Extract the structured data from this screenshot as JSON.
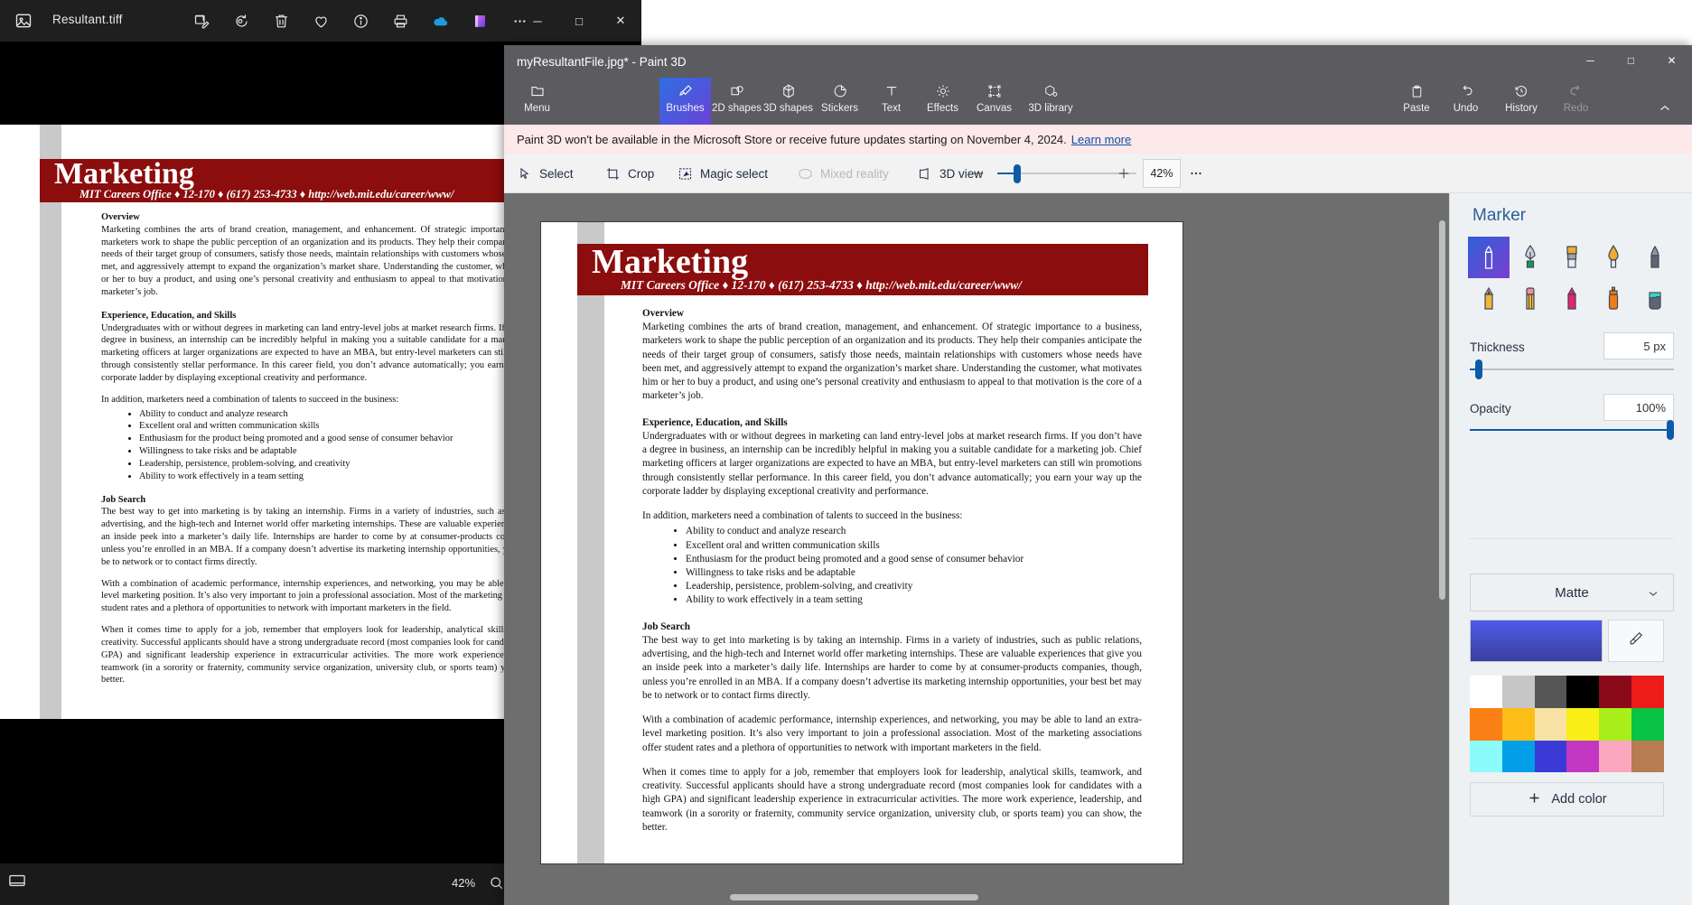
{
  "photos_window": {
    "app_icon": "photo-icon",
    "filename": "Resultant.tiff",
    "toolbar_icons": [
      {
        "name": "edit-image-icon",
        "label": "Edit image"
      },
      {
        "name": "rotate-icon",
        "label": "Rotate"
      },
      {
        "name": "delete-icon",
        "label": "Delete"
      },
      {
        "name": "favorite-heart-icon",
        "label": "Add to favorites"
      },
      {
        "name": "info-icon",
        "label": "File info"
      },
      {
        "name": "print-icon",
        "label": "Print"
      },
      {
        "name": "onedrive-icon",
        "label": "OneDrive"
      },
      {
        "name": "designer-icon",
        "label": "Designer"
      },
      {
        "name": "more-icon",
        "label": "See more"
      }
    ],
    "window_controls": {
      "minimize": "─",
      "maximize": "□",
      "close": "✕"
    },
    "status": {
      "zoom": "42%",
      "zoom_icon": "magnifier-icon",
      "gallery_icon": "filmstrip-icon"
    }
  },
  "paint3d": {
    "title": "myResultantFile.jpg* - Paint 3D",
    "window_controls": {
      "minimize": "─",
      "maximize": "□",
      "close": "✕"
    },
    "ribbon": {
      "menu": {
        "label": "Menu",
        "icon": "folder-icon"
      },
      "tools": [
        {
          "label": "Brushes",
          "icon": "brush-icon",
          "selected": true
        },
        {
          "label": "2D shapes",
          "icon": "2d-shapes-icon",
          "selected": false
        },
        {
          "label": "3D shapes",
          "icon": "3d-shapes-icon",
          "selected": false
        },
        {
          "label": "Stickers",
          "icon": "stickers-icon",
          "selected": false
        },
        {
          "label": "Text",
          "icon": "text-icon",
          "selected": false
        },
        {
          "label": "Effects",
          "icon": "effects-icon",
          "selected": false
        },
        {
          "label": "Canvas",
          "icon": "canvas-icon",
          "selected": false
        },
        {
          "label": "3D library",
          "icon": "3d-library-icon",
          "selected": false
        }
      ],
      "right_tools": [
        {
          "label": "Paste",
          "icon": "paste-icon",
          "disabled": false
        },
        {
          "label": "Undo",
          "icon": "undo-icon",
          "disabled": false
        },
        {
          "label": "History",
          "icon": "history-icon",
          "disabled": false
        },
        {
          "label": "Redo",
          "icon": "redo-icon",
          "disabled": true
        }
      ],
      "collapse_icon": "chevron-up-icon"
    },
    "banner": {
      "text": "Paint 3D won't be available in the Microsoft Store or receive future updates starting on November 4, 2024.",
      "link": "Learn more"
    },
    "toolstrip": {
      "items": [
        {
          "label": "Select",
          "icon": "cursor-select-icon",
          "disabled": false
        },
        {
          "label": "Crop",
          "icon": "crop-icon",
          "disabled": false
        },
        {
          "label": "Magic select",
          "icon": "magic-select-icon",
          "disabled": false
        },
        {
          "label": "Mixed reality",
          "icon": "mixed-reality-icon",
          "disabled": true
        },
        {
          "label": "3D view",
          "icon": "3d-view-icon",
          "disabled": false
        }
      ],
      "zoom_out_icon": "minus-icon",
      "zoom_in_icon": "plus-icon",
      "zoom_value": "42%",
      "more_icon": "more-icon"
    },
    "panel": {
      "title": "Marker",
      "brushes": [
        {
          "name": "marker-brush",
          "selected": true
        },
        {
          "name": "calligraphy-pen-brush",
          "selected": false
        },
        {
          "name": "oil-brush",
          "selected": false
        },
        {
          "name": "watercolor-brush",
          "selected": false
        },
        {
          "name": "pixel-pen-brush",
          "selected": false
        },
        {
          "name": "pencil-brush",
          "selected": false
        },
        {
          "name": "eraser-brush",
          "selected": false
        },
        {
          "name": "crayon-brush",
          "selected": false
        },
        {
          "name": "spray-can-brush",
          "selected": false
        },
        {
          "name": "fill-bucket-brush",
          "selected": false
        }
      ],
      "thickness": {
        "label": "Thickness",
        "value": "5 px",
        "percent": 4
      },
      "opacity": {
        "label": "Opacity",
        "value": "100%",
        "percent": 100
      },
      "material": {
        "value": "Matte",
        "chevron": "chevron-down-icon"
      },
      "current_color": "#4550d8",
      "eyedropper_icon": "eyedropper-icon",
      "swatches": [
        "#ffffff",
        "#c6c6c6",
        "#565656",
        "#000000",
        "#8b0a1a",
        "#ee1b1b",
        "#fa8016",
        "#fbbd16",
        "#f8e2a3",
        "#f9ef16",
        "#a8ef1a",
        "#09c344",
        "#8cfbfb",
        "#029fe8",
        "#3a3ad6",
        "#c238c2",
        "#fca7c0",
        "#b77c52"
      ],
      "add_color": {
        "label": "Add color",
        "icon": "plus-icon"
      }
    }
  },
  "document": {
    "header_title": "Marketing",
    "header_sub": "MIT Careers Office ♦ 12-170 ♦ (617) 253-4733 ♦ http://web.mit.edu/career/www/",
    "sections": [
      {
        "heading": "Overview",
        "paragraphs": [
          "Marketing combines the arts of brand creation, management, and enhancement.  Of strategic importance to a business, marketers work to shape the public perception of an organization and its products.  They help their companies anticipate the needs of their target group of consumers, satisfy those needs, maintain relationships with customers whose needs have been met, and aggressively attempt to expand the organization’s market share.  Understanding the customer, what motivates him or her to buy a product, and using one’s personal creativity and enthusiasm to appeal to that motivation is the core of a marketer’s job."
        ]
      },
      {
        "heading": "Experience, Education, and Skills",
        "paragraphs": [
          "Undergraduates with or without degrees in marketing can land entry-level jobs at market research firms.  If you don’t have a degree in business, an internship can be incredibly helpful in making you a suitable candidate for a marketing job.  Chief marketing officers at larger organizations are expected to have an MBA, but entry-level marketers can still win promotions through consistently stellar performance.  In this career field, you don’t advance automatically; you earn your way up the corporate ladder by displaying exceptional creativity and performance.",
          "In addition, marketers need a combination of talents to succeed in the business:"
        ],
        "bullets": [
          "Ability to conduct and analyze research",
          "Excellent oral and written communication skills",
          "Enthusiasm for the product being promoted and a good sense of consumer behavior",
          "Willingness to take risks and be adaptable",
          "Leadership, persistence, problem-solving, and creativity",
          "Ability to work effectively in a team setting"
        ]
      },
      {
        "heading": "Job Search",
        "paragraphs": [
          "The best way to get into marketing is by taking an internship.  Firms in a variety of industries, such as public relations, advertising, and the high-tech and Internet world offer marketing internships.  These are valuable experiences that give you an inside peek into a marketer’s daily life.  Internships are harder to come by at consumer-products companies, though, unless you’re enrolled in an MBA.  If a company doesn’t advertise its marketing internship opportunities, your best bet may be to network or to contact firms directly.",
          "With a combination of academic performance, internship experiences, and networking, you may be able to land an extra-level marketing position.  It’s also very important to join a professional association.  Most of the marketing associations offer student rates and a plethora of opportunities to network with important marketers in the field.",
          "When it comes time to apply for a job, remember that employers look for leadership, analytical skills, teamwork, and creativity.  Successful applicants should have a strong undergraduate record (most companies look for candidates with a high GPA) and significant leadership experience in extracurricular activities.  The more work experience, leadership, and teamwork (in a sorority or fraternity, community service organization, university club, or sports team) you can show, the better."
        ]
      }
    ]
  }
}
